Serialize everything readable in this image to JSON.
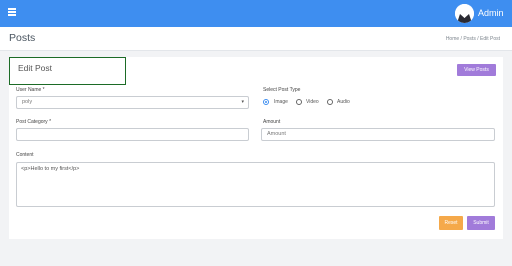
{
  "header": {
    "menu_icon": "hamburger-menu-icon",
    "avatar_icon": "user-avatar-icon",
    "user_label": "Admin",
    "accent_color": "#3e8ef0"
  },
  "page": {
    "title": "Posts",
    "breadcrumb": "Home  /  Posts  /  Edit Post"
  },
  "card": {
    "title": "Edit Post",
    "view_posts_label": "View Posts"
  },
  "form": {
    "user_name_label": "User Name *",
    "user_name_value": "poly",
    "post_type_label": "Select Post Type",
    "post_types": [
      {
        "label": "Image",
        "checked": true
      },
      {
        "label": "Video",
        "checked": false
      },
      {
        "label": "Audio",
        "checked": false
      }
    ],
    "post_category_label": "Post Category *",
    "post_category_value": "",
    "amount_label": "Amount",
    "amount_placeholder": "Amount",
    "content_label": "Content",
    "content_value": "<p>Hello to my first</p>",
    "reset_label": "Reset",
    "submit_label": "Submit"
  }
}
